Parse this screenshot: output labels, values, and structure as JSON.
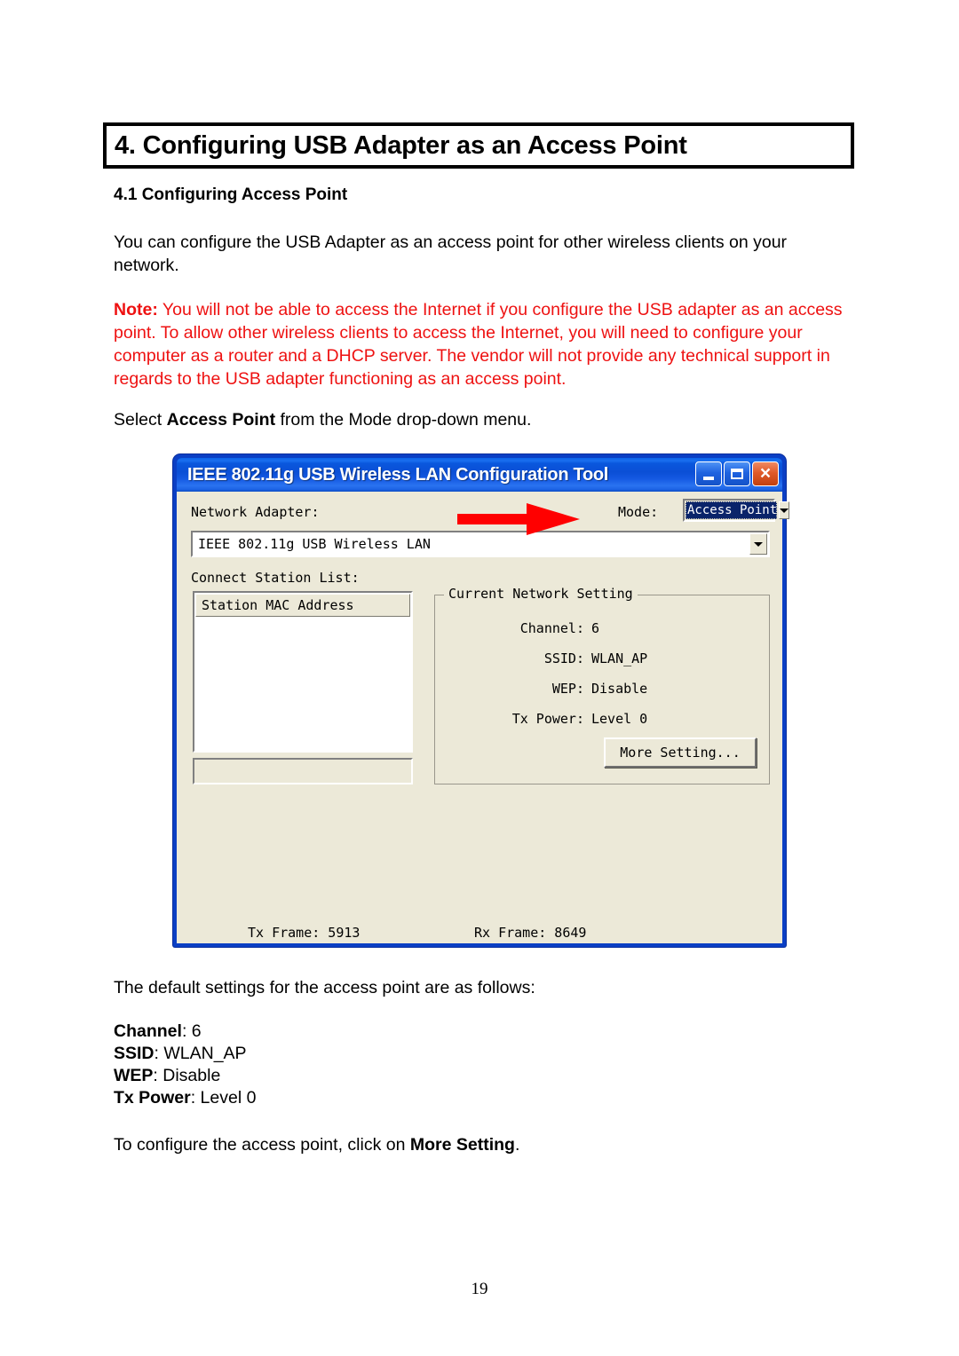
{
  "document": {
    "chapter_title": "4. Configuring USB Adapter as an Access Point",
    "sub_heading": "4.1 Configuring Access Point",
    "intro_paragraph": "You can configure the USB Adapter as an access point for other wireless clients on your network.",
    "note_label": "Note:",
    "note_body": " You will not be able to access the Internet if you configure the USB adapter as an access point. To allow other wireless clients to access the Internet, you will need to configure your computer as a router and a DHCP server. The vendor will not provide any technical support in regards to the USB adapter functioning as an access point.",
    "select_prefix": "Select ",
    "select_bold": "Access Point",
    "select_suffix": " from the Mode drop-down menu.",
    "defaults_lead": "The default settings for the access point are as follows:",
    "defaults": [
      {
        "label": "Channel",
        "value": ": 6"
      },
      {
        "label": "SSID",
        "value": ": WLAN_AP"
      },
      {
        "label": "WEP",
        "value": ": Disable"
      },
      {
        "label": "Tx Power",
        "value": ": Level 0"
      }
    ],
    "closing_prefix": "To configure the access point, click on ",
    "closing_bold": "More Setting",
    "closing_suffix": ".",
    "page_number": "19"
  },
  "dialog": {
    "title": "IEEE 802.11g USB Wireless LAN Configuration Tool",
    "window_buttons": {
      "minimize": "minimize-icon",
      "maximize": "maximize-icon",
      "close": "×"
    },
    "network_adapter_label": "Network Adapter:",
    "adapter_value": "IEEE 802.11g USB Wireless LAN",
    "mode_label": "Mode:",
    "mode_value": "Access Point",
    "connect_station_label": "Connect Station List:",
    "station_list_header": "Station MAC Address",
    "station_list_rows": [],
    "station_status_text": "",
    "group": {
      "legend": "Current Network Setting",
      "rows": [
        {
          "key": "Channel:",
          "value": "6"
        },
        {
          "key": "SSID:",
          "value": "WLAN_AP"
        },
        {
          "key": "WEP:",
          "value": "Disable"
        },
        {
          "key": "Tx Power:",
          "value": "Level 0"
        }
      ],
      "more_setting_button": "More Setting..."
    },
    "tx_frame": "Tx Frame: 5913",
    "rx_frame": "Rx Frame: 8649"
  },
  "annotation": {
    "arrow": "red-arrow-pointing-right",
    "arrow_color": "#ff0000"
  },
  "colors": {
    "note_red": "#ee1111",
    "title_bar_blue": "#0b4fd6",
    "dialog_face": "#ece9d8",
    "selection_blue": "#0a246a"
  }
}
